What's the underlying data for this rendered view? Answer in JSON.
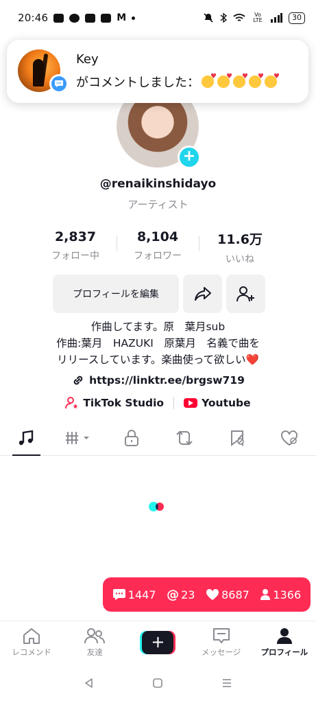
{
  "status": {
    "time": "20:46",
    "battery": "30",
    "network": "Vo LTE"
  },
  "notification": {
    "sender": "Key",
    "message": "がコメントしました：",
    "emoji_count": 5,
    "badge_icon": "comment-bubble-icon"
  },
  "profile": {
    "username": "@renaikinshidayo",
    "category": "アーティスト",
    "stats": [
      {
        "value": "2,837",
        "label": "フォロー中"
      },
      {
        "value": "8,104",
        "label": "フォロワー"
      },
      {
        "value": "11.6万",
        "label": "いいね"
      }
    ],
    "edit_label": "プロフィールを編集",
    "bio": [
      "作曲してます。原　葉月sub",
      "作曲:葉月　HAZUKI　原葉月　名義で曲を",
      "リリースしています。楽曲使って欲しい"
    ],
    "bio_heart": "❤️",
    "link": "https://linktr.ee/brgsw719",
    "studio_label": "TikTok Studio",
    "youtube_label": "Youtube"
  },
  "tabs": [
    {
      "icon": "music-note-icon",
      "active": true
    },
    {
      "icon": "playlist-dropdown-icon",
      "active": false
    },
    {
      "icon": "lock-icon",
      "active": false
    },
    {
      "icon": "repost-icon",
      "active": false
    },
    {
      "icon": "bookmark-icon",
      "active": false
    },
    {
      "icon": "liked-icon",
      "active": false
    }
  ],
  "floating_stats": {
    "comments": "1447",
    "mentions": "23",
    "likes": "8687",
    "followers": "1366"
  },
  "bottom_nav": {
    "home": "レコメンド",
    "friends": "友達",
    "inbox": "メッセージ",
    "profile": "プロフィール"
  },
  "colors": {
    "accent": "#fe2c55",
    "cyan": "#25f4ee",
    "text": "#161823",
    "muted": "#8a8b91"
  }
}
